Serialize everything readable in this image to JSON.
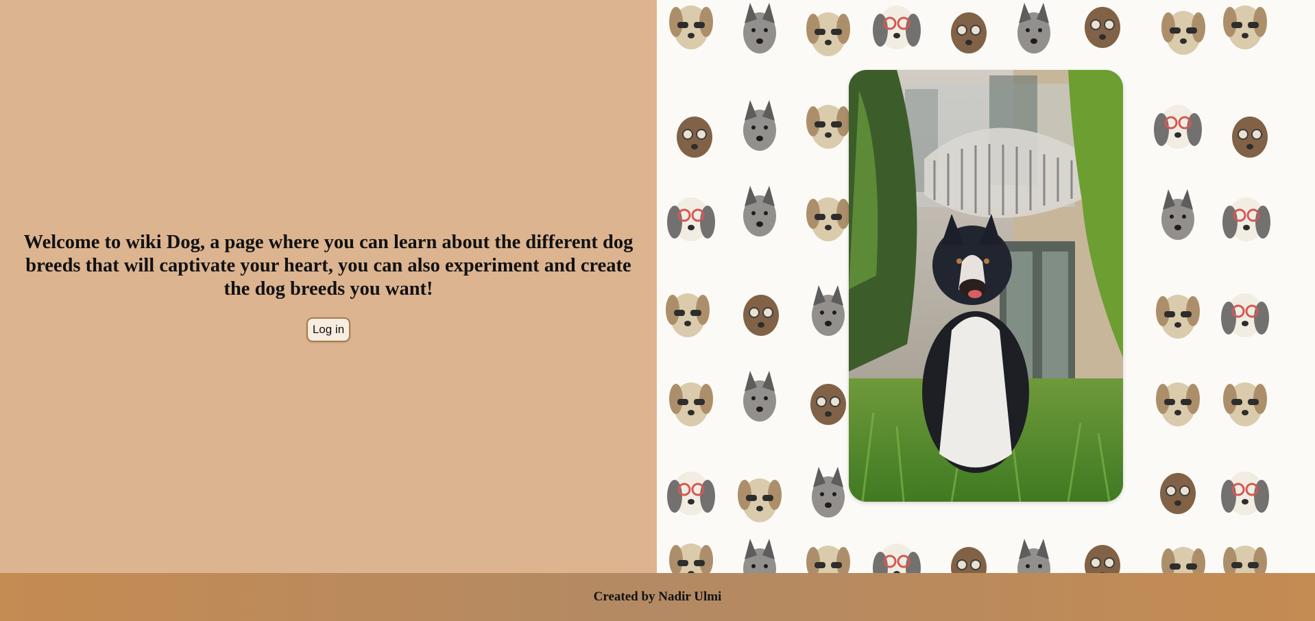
{
  "main": {
    "welcome_message": "Welcome to wiki Dog, a page where you can learn about the different dog breeds that will captivate your heart, you can also experiment and create the dog breeds you want!",
    "login_label": "Log in"
  },
  "hero": {
    "background_icon": "dog-faces-pattern",
    "photo_icon": "australian-shepherd-photo"
  },
  "footer": {
    "credit": "Created by Nadir Ulmi"
  },
  "colors": {
    "left_panel": "#dcb490",
    "footer": "#c48b52",
    "pattern_background": "#fbfaf6"
  }
}
